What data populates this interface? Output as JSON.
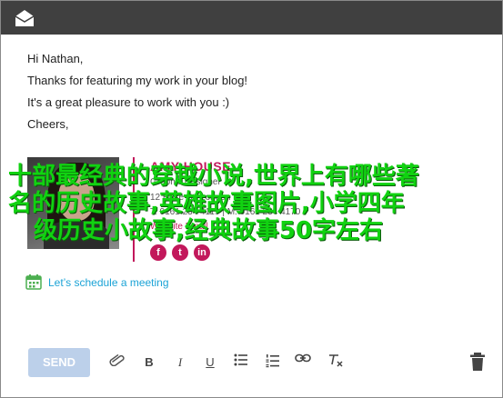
{
  "email": {
    "greeting": "Hi Nathan,",
    "line1": "Thanks for featuring my work in your blog!",
    "line2": "It's a great pleasure to work with you :)",
    "closing": "Cheers,"
  },
  "signature": {
    "name": "AMY HOUSE",
    "title": "Graphic Designer",
    "address": "12 Rose St, London",
    "phone": "T: 0161 234 4119 | M: 0161 234 4170",
    "link": "Website  Email",
    "accent_color": "#c2185b"
  },
  "overlay": {
    "line1": "十部最经典的穿越小说,世界上有哪些著",
    "line2": "名的历史故事,英雄故事图片,小学四年",
    "line3": "级历史小故事,经典故事50字左右",
    "color": "#11d211"
  },
  "schedule": {
    "label": "Let’s schedule a meeting",
    "icon": "calendar-icon"
  },
  "toolbar": {
    "send_label": "SEND",
    "bold": "B",
    "italic": "I",
    "underline": "U"
  }
}
